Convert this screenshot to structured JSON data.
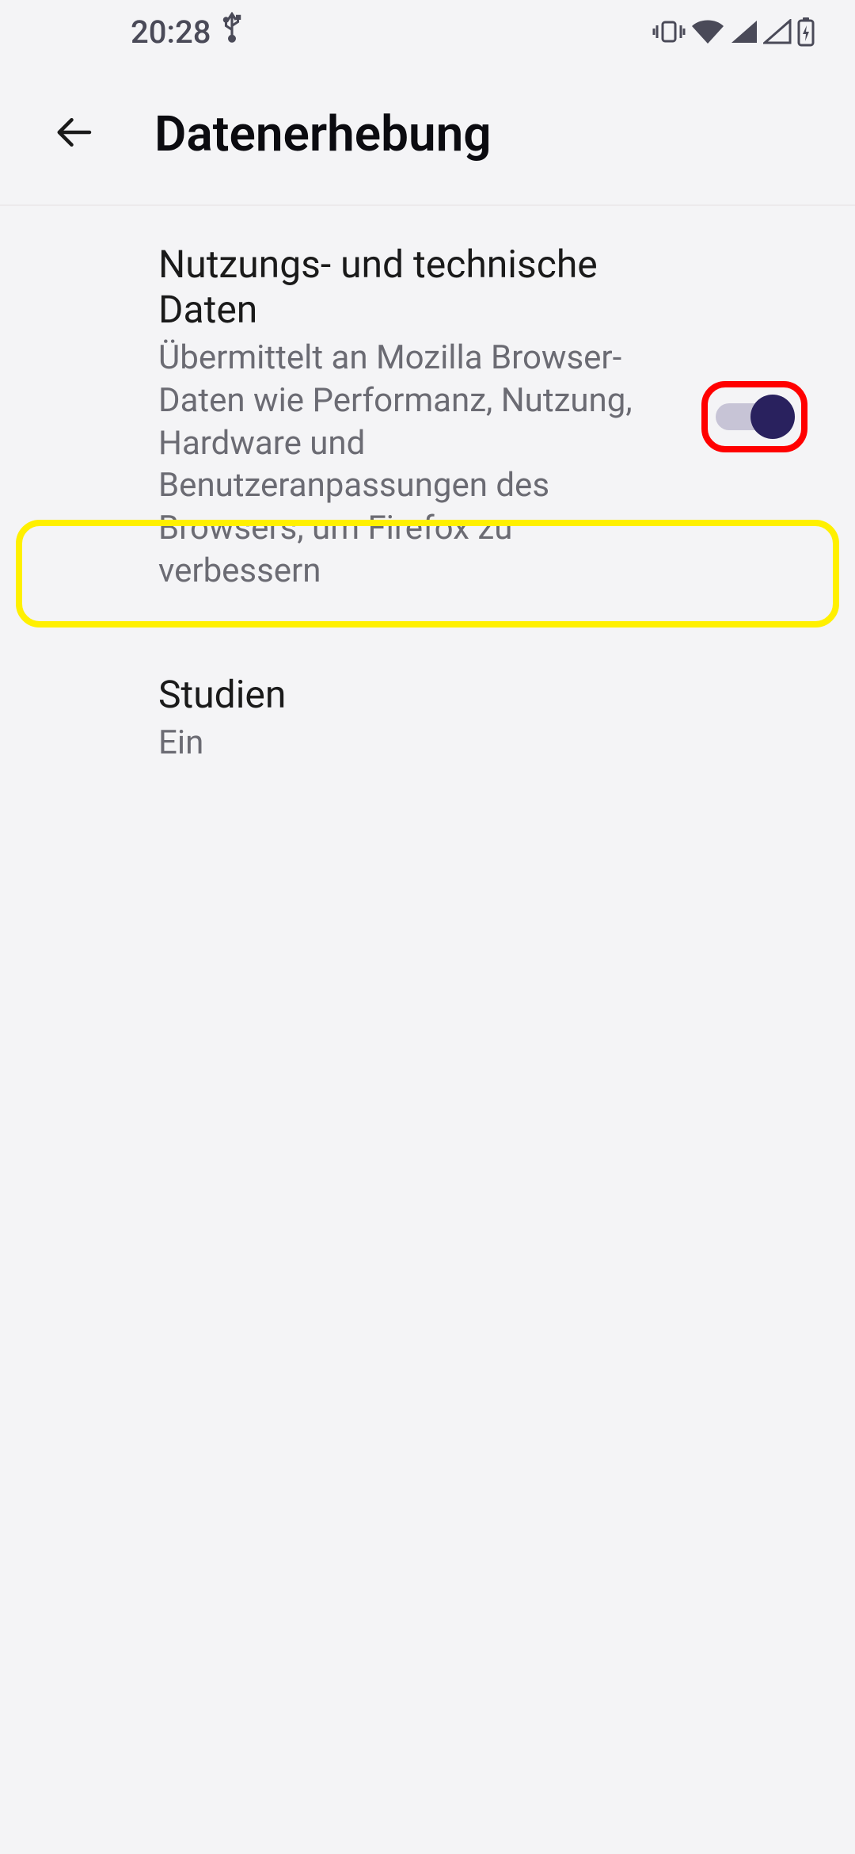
{
  "status": {
    "time": "20:28"
  },
  "header": {
    "title": "Datenerhebung"
  },
  "items": [
    {
      "title": "Nutzungs- und technische Daten",
      "description": "Übermittelt an Mozilla Browser-Daten wie Performanz, Nutzung, Hardware und Benutzeranpassungen des Browsers, um Firefox zu verbessern",
      "toggle": true
    },
    {
      "title": "Studien",
      "description": "Ein"
    }
  ]
}
